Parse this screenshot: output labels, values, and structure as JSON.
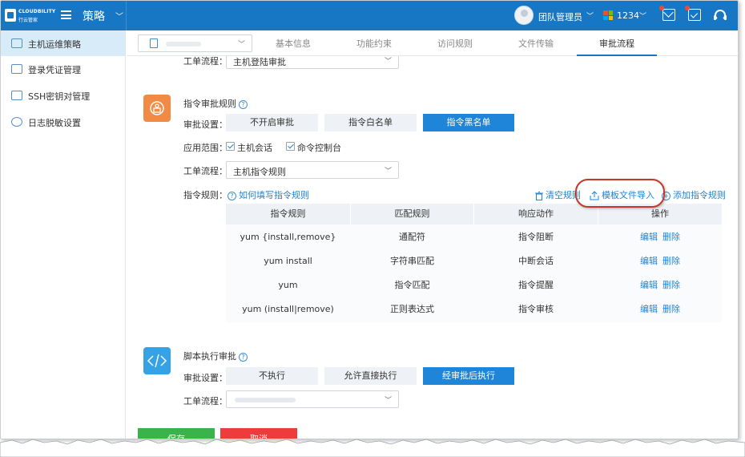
{
  "topbar": {
    "brand": "CLOUDBILITY",
    "brand_sub": "行云管家",
    "module_title": "策略",
    "username": "团队管理员",
    "counter": "1234",
    "colors": {
      "bar": "#1777c5",
      "notify": "#e84c3d"
    },
    "icons": [
      "menu-icon",
      "avatar",
      "windows-icon",
      "mail-icon",
      "task-icon",
      "headset-icon"
    ]
  },
  "sidebar": {
    "items": [
      {
        "label": "主机运维策略",
        "icon": "host-policy-icon",
        "active": true
      },
      {
        "label": "登录凭证管理",
        "icon": "credential-icon",
        "active": false
      },
      {
        "label": "SSH密钥对管理",
        "icon": "key-icon",
        "active": false
      },
      {
        "label": "日志脱敏设置",
        "icon": "eye-icon",
        "active": false
      }
    ]
  },
  "tabs": {
    "items": [
      "基本信息",
      "功能约束",
      "访问规则",
      "文件传输",
      "审批流程"
    ],
    "active": "审批流程"
  },
  "top_flow": {
    "label": "工单流程：",
    "value": "主机登陆审批"
  },
  "cmd_section": {
    "title": "指令审批规则",
    "setting_label": "审批设置：",
    "options": [
      "不开启审批",
      "指令白名单",
      "指令黑名单"
    ],
    "selected": "指令黑名单",
    "scope_label": "应用范围：",
    "scope_options": [
      {
        "label": "主机会话",
        "checked": true
      },
      {
        "label": "命令控制台",
        "checked": true
      }
    ],
    "flow_label": "工单流程：",
    "flow_value": "主机指令规则",
    "rules_label": "指令规则：",
    "help_link": "如何填写指令规则",
    "actions": {
      "clear": "清空规则",
      "import": "模板文件导入",
      "add": "添加指令规则"
    },
    "table": {
      "headers": [
        "指令规则",
        "匹配规则",
        "响应动作",
        "操作"
      ],
      "rows": [
        {
          "rule": "yum {install,remove}",
          "match": "通配符",
          "action": "指令阻断",
          "edit": "编辑",
          "delete": "删除"
        },
        {
          "rule": "yum install",
          "match": "字符串匹配",
          "action": "中断会话",
          "edit": "编辑",
          "delete": "删除"
        },
        {
          "rule": "yum",
          "match": "指令匹配",
          "action": "指令提醒",
          "edit": "编辑",
          "delete": "删除"
        },
        {
          "rule": "yum (install|remove)",
          "match": "正则表达式",
          "action": "指令审核",
          "edit": "编辑",
          "delete": "删除"
        }
      ]
    }
  },
  "script_section": {
    "title": "脚本执行审批",
    "setting_label": "审批设置：",
    "options": [
      "不执行",
      "允许直接执行",
      "经审批后执行"
    ],
    "selected": "经审批后执行",
    "flow_label": "工单流程："
  },
  "footer": {
    "save": "保存",
    "cancel": "取消"
  },
  "colors": {
    "primary": "#1e85d9",
    "save": "#3bb34a",
    "cancel": "#ee3b3b",
    "highlight": "#c0392b"
  }
}
